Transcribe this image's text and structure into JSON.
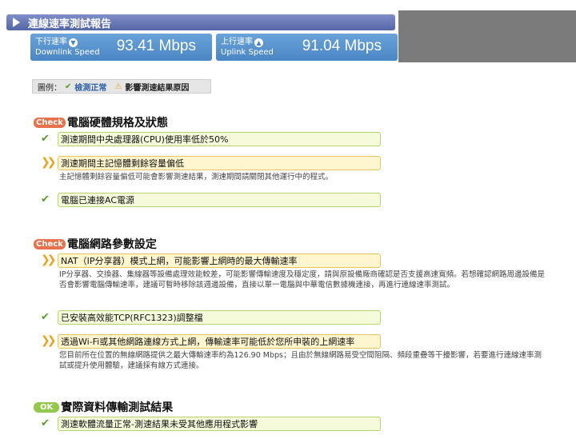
{
  "header": {
    "title": "連線速率測試報告"
  },
  "speeds": {
    "down": {
      "label_zh": "下行速率",
      "label_en": "Downlink Speed",
      "value": "93.41 Mbps"
    },
    "up": {
      "label_zh": "上行速率",
      "label_en": "Uplink Speed",
      "value": "91.04 Mbps"
    }
  },
  "legend": {
    "prefix": "圖例：",
    "ok": "檢測正常",
    "warn": "影響測速結果原因"
  },
  "sections": {
    "hw": {
      "tag": "Check",
      "title": "電腦硬體規格及狀態",
      "items": [
        {
          "text": "測速期間中央處理器(CPU)使用率低於50%"
        },
        {
          "text": "測速期間主記憶體剩餘容量偏低",
          "desc": "主記憶體剩餘容量偏低可能會影響測速結果，測速期間請關閉其他運行中的程式。"
        },
        {
          "text": "電腦已連接AC電源"
        }
      ]
    },
    "net": {
      "tag": "Check",
      "title": "電腦網路參數設定",
      "items": [
        {
          "text": "NAT（IP分享器）模式上網，可能影響上網時的最大傳輸速率",
          "desc": "IP分享器、交換器、集線器等設備處理效能較差，可能影響傳輸速度及穩定度，請與原設備廠商確認是否支援高速寬頻。若想確認網路周邊設備是否會影響電腦傳輸速率，建議可暫時移除該週邊設備，直接以單一電腦與中華電信數據機連接，再進行連線速率測試。"
        },
        {
          "text": "已安裝高效能TCP(RFC1323)調整檔"
        },
        {
          "text": "透過Wi-Fi或其他網路連線方式上網，傳輸速率可能低於您所申裝的上網速率",
          "desc": "您目前所在位置的無線網路提供之最大傳輸速率約為126.90 Mbps；且由於無線網路易受空間阻隔、頻段重疊等干擾影響，若要進行連線速率測試或提升使用體驗，建議採有線方式連接。"
        }
      ]
    },
    "result": {
      "tag": "OK",
      "title": "實際資料傳輸測試結果",
      "items": [
        {
          "text": "測速軟體流量正常-測速結果未受其他應用程式影響"
        }
      ]
    }
  }
}
